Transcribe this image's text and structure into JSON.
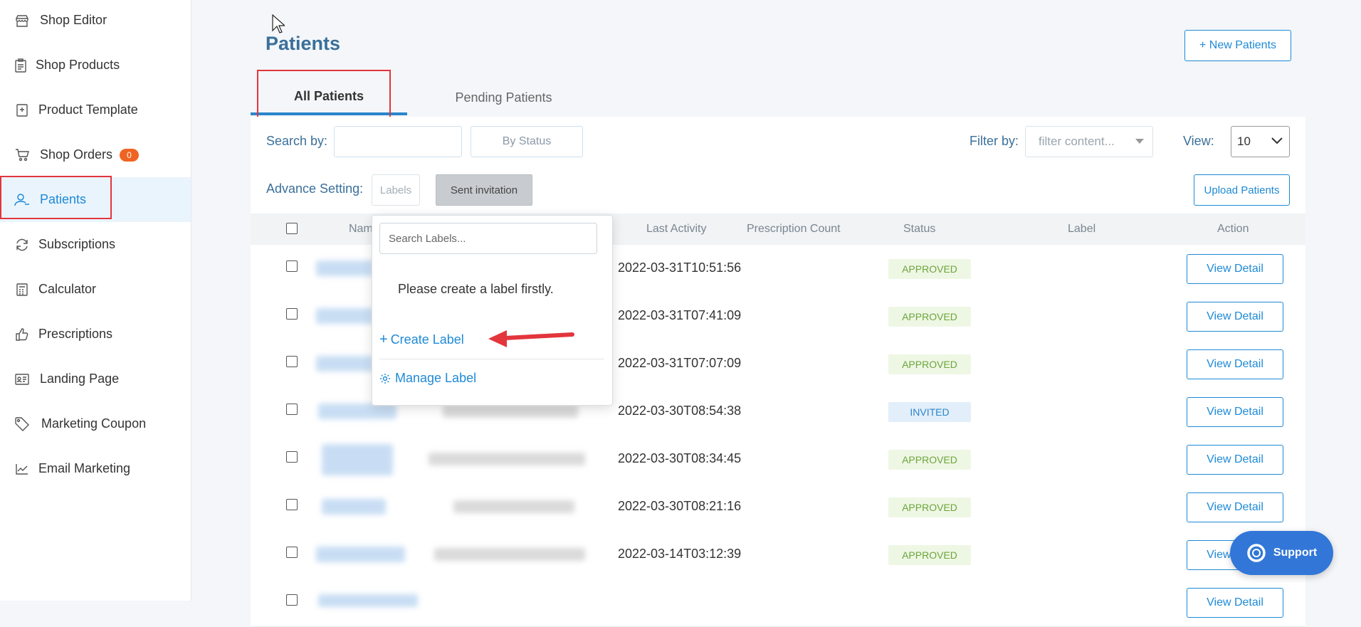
{
  "sidebar": {
    "items": [
      {
        "label": "Shop Editor",
        "icon": "store-icon"
      },
      {
        "label": "Shop Products",
        "icon": "clipboard-icon"
      },
      {
        "label": "Product Template",
        "icon": "template-icon"
      },
      {
        "label": "Shop Orders",
        "icon": "cart-icon",
        "badge": "0"
      },
      {
        "label": "Patients",
        "icon": "user-icon",
        "active": true
      },
      {
        "label": "Subscriptions",
        "icon": "refresh-icon"
      },
      {
        "label": "Calculator",
        "icon": "calculator-icon"
      },
      {
        "label": "Prescriptions",
        "icon": "thumbs-up-icon"
      },
      {
        "label": "Landing Page",
        "icon": "id-card-icon"
      },
      {
        "label": "Marketing Coupon",
        "icon": "tag-icon"
      },
      {
        "label": "Email Marketing",
        "icon": "chart-line-icon"
      }
    ]
  },
  "header": {
    "title": "Patients",
    "new_button": "+ New Patients"
  },
  "tabs": [
    {
      "label": "All Patients",
      "active": true
    },
    {
      "label": "Pending Patients"
    }
  ],
  "filters": {
    "search_label": "Search by:",
    "search_value": "",
    "by_status": "By Status",
    "filter_label": "Filter by:",
    "filter_placeholder": "filter content...",
    "view_label": "View:",
    "view_value": "10",
    "advance_label": "Advance Setting:",
    "labels_button": "Labels",
    "sent_invitation": "Sent invitation",
    "upload_button": "Upload Patients"
  },
  "table": {
    "headers": [
      "Name",
      "Last Activity",
      "Prescription Count",
      "Status",
      "Label",
      "Action"
    ],
    "header_visible_name": "Nam",
    "action_label": "View Detail",
    "rows": [
      {
        "last_activity": "2022-03-31T10:51:56",
        "status": "APPROVED",
        "kind": "approved"
      },
      {
        "last_activity": "2022-03-31T07:41:09",
        "status": "APPROVED",
        "kind": "approved"
      },
      {
        "last_activity": "2022-03-31T07:07:09",
        "status": "APPROVED",
        "kind": "approved"
      },
      {
        "last_activity": "2022-03-30T08:54:38",
        "status": "INVITED",
        "kind": "invited"
      },
      {
        "last_activity": "2022-03-30T08:34:45",
        "status": "APPROVED",
        "kind": "approved"
      },
      {
        "last_activity": "2022-03-30T08:21:16",
        "status": "APPROVED",
        "kind": "approved"
      },
      {
        "last_activity": "2022-03-14T03:12:39",
        "status": "APPROVED",
        "kind": "approved"
      }
    ]
  },
  "label_popup": {
    "search_placeholder": "Search Labels...",
    "empty_message": "Please create a label firstly.",
    "create_label": "Create Label",
    "manage_label": "Manage Label"
  },
  "support": {
    "label": "Support"
  },
  "colors": {
    "accent": "#1e8ad6",
    "title": "#3a6f9a",
    "highlight": "#e3353c",
    "badge": "#f06423",
    "support": "#3277d8"
  }
}
